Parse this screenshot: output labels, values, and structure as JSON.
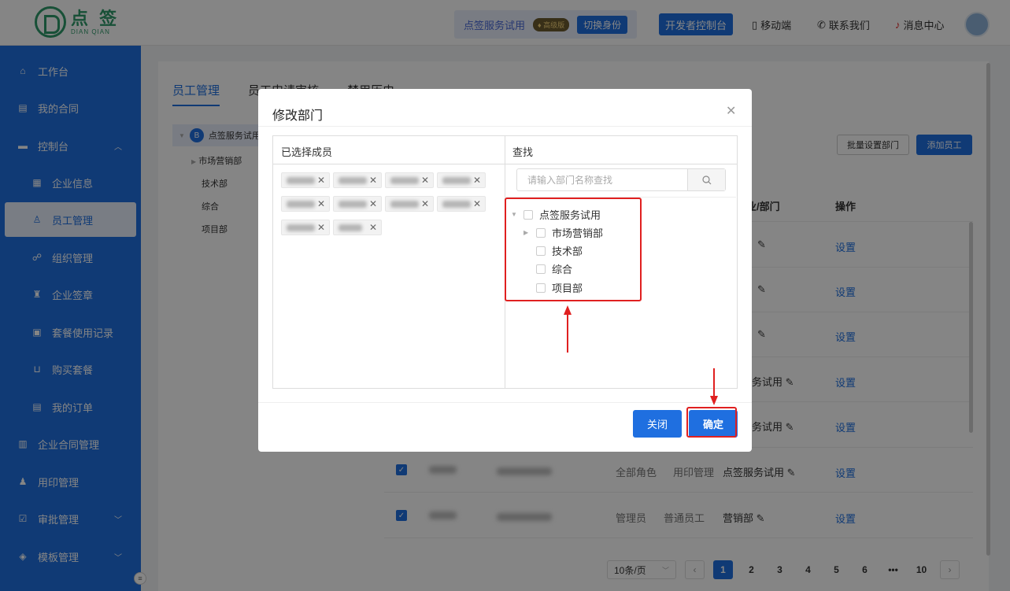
{
  "app": {
    "logo_cn": "点 签",
    "logo_en": "DIAN QIAN"
  },
  "topbar": {
    "tenant_name": "点签服务试用",
    "vip_label": "高级版",
    "switch_label": "切换身份",
    "dev_console": "开发者控制台",
    "mobile": "移动端",
    "contact": "联系我们",
    "messages": "消息中心"
  },
  "sidebar": {
    "items": [
      {
        "label": "工作台",
        "icon": "home-icon"
      },
      {
        "label": "我的合同",
        "icon": "document-icon"
      },
      {
        "label": "控制台",
        "icon": "console-icon"
      },
      {
        "label": "企业信息",
        "icon": "building-icon"
      },
      {
        "label": "员工管理",
        "icon": "user-icon"
      },
      {
        "label": "组织管理",
        "icon": "org-icon"
      },
      {
        "label": "企业签章",
        "icon": "stamp-icon"
      },
      {
        "label": "套餐使用记录",
        "icon": "record-icon"
      },
      {
        "label": "购买套餐",
        "icon": "cart-icon"
      },
      {
        "label": "我的订单",
        "icon": "order-icon"
      },
      {
        "label": "企业合同管理",
        "icon": "contract-icon"
      },
      {
        "label": "用印管理",
        "icon": "seal-icon"
      },
      {
        "label": "审批管理",
        "icon": "approve-icon"
      },
      {
        "label": "模板管理",
        "icon": "template-icon"
      }
    ]
  },
  "main": {
    "tabs": [
      "员工管理",
      "员工申请审核",
      "禁用历史"
    ],
    "dept_tree": {
      "root": "点签服务试用",
      "children": [
        "市场营销部",
        "技术部",
        "综合",
        "项目部"
      ]
    },
    "batch_set_dept": "批量设置部门",
    "add_employee": "添加员工",
    "columns": {
      "dept": "企业/部门",
      "actions": "操作"
    },
    "rows": [
      {
        "dept": "",
        "action": "设置"
      },
      {
        "dept": "",
        "action": "设置"
      },
      {
        "dept": "",
        "action": "设置"
      },
      {
        "dept": "务试用",
        "action": "设置"
      },
      {
        "dept": "务试用",
        "action": "设置"
      },
      {
        "role": "全部角色",
        "role2": "用印管理",
        "dept": "点签服务试用",
        "action": "设置"
      },
      {
        "role": "管理员",
        "role2": "普通员工",
        "dept": "营销部",
        "action": "设置"
      }
    ],
    "pager": {
      "page_size": "10条/页",
      "pages": [
        "1",
        "2",
        "3",
        "4",
        "5",
        "6",
        "•••",
        "10"
      ],
      "current": "1"
    }
  },
  "modal": {
    "title": "修改部门",
    "selected_header": "已选择成员",
    "search_header": "查找",
    "search_placeholder": "请输入部门名称查找",
    "tree": {
      "root": "点签服务试用",
      "children": [
        "市场营销部",
        "技术部",
        "综合",
        "项目部"
      ]
    },
    "close_label": "关闭",
    "ok_label": "确定"
  },
  "colors": {
    "primary": "#1f6fe0",
    "brand_green": "#2f9a6a",
    "annotation_red": "#e02020"
  }
}
